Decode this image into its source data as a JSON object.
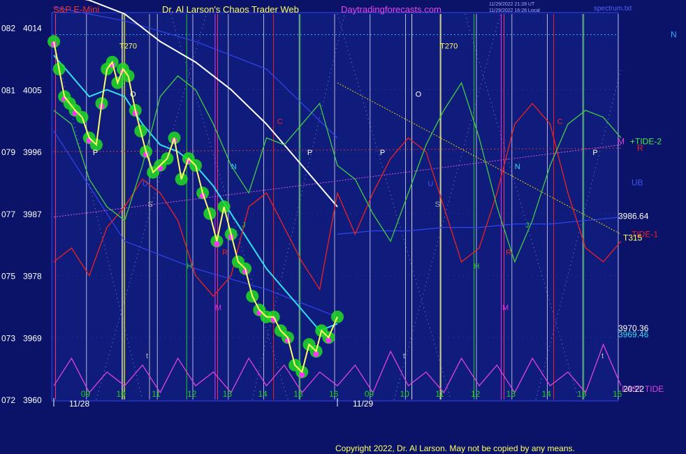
{
  "header": {
    "symbol": "S&P E-Mini",
    "site_title": "Dr. Al Larson's Chaos Trader Web",
    "site_url": "Daytradingforecasts.com",
    "timestamp_line1": "11/29/2022 21:28 UT",
    "timestamp_line2": "11/29/2022 16:28 Local",
    "spectrum_file": "spectrum.txt"
  },
  "footer": {
    "copyright": "Copyright 2022, Dr. Al Larson. May not be copied by any means."
  },
  "colors": {
    "background": "#0a1368",
    "plot_background": "#101c7c",
    "price": "#ffff66",
    "price_glow_bars": "#22dd22",
    "price_dots": "#ff33ff",
    "ema_fast": "#33ddee",
    "ema_slow": "#ffffff",
    "tide_1": "#ee2222",
    "tide_2": "#44cc44",
    "fast_tide": "#dd44dd",
    "channel": "#3344ee",
    "trendline": "#e8d000"
  },
  "chart_data": {
    "type": "line",
    "title": "S&P E-Mini",
    "y_ticks": [
      {
        "code": "082",
        "price": "4014"
      },
      {
        "code": "081",
        "price": "4005"
      },
      {
        "code": "079",
        "price": "3996"
      },
      {
        "code": "077",
        "price": "3987"
      },
      {
        "code": "075",
        "price": "3978"
      },
      {
        "code": "073",
        "price": "3969"
      },
      {
        "code": "072",
        "price": "3960"
      }
    ],
    "ylim": [
      3960,
      4016
    ],
    "x_hours": [
      "09",
      "10",
      "11",
      "12",
      "13",
      "14",
      "15",
      "16",
      "09",
      "10",
      "11",
      "12",
      "13",
      "14",
      "15",
      "16"
    ],
    "x_dates": [
      "11/28",
      "11/29"
    ],
    "grid": true,
    "series": [
      {
        "name": "price",
        "x": [
          0,
          0.15,
          0.3,
          0.45,
          0.6,
          0.8,
          1.0,
          1.2,
          1.35,
          1.5,
          1.65,
          1.8,
          1.95,
          2.1,
          2.3,
          2.45,
          2.6,
          2.8,
          3.0,
          3.2,
          3.4,
          3.6,
          3.8,
          4.0,
          4.2,
          4.4,
          4.6,
          4.8,
          5.0,
          5.2,
          5.4,
          5.6,
          5.8,
          6.0,
          6.2,
          6.4,
          6.6,
          6.8,
          7.0,
          7.2,
          7.4,
          7.55,
          7.75,
          8.0
        ],
        "values": [
          4012,
          4008,
          4004,
          4003,
          4002,
          4001,
          3998,
          3997,
          4003,
          4008,
          4009,
          4006,
          4008,
          4007,
          4002,
          3999,
          3996,
          3993,
          3994,
          3995,
          3998,
          3992,
          3995,
          3994,
          3990,
          3987,
          3983,
          3988,
          3984,
          3980,
          3979,
          3975,
          3973,
          3972,
          3972,
          3970,
          3969,
          3965,
          3964,
          3968,
          3967,
          3970,
          3969,
          3972
        ]
      },
      {
        "name": "ema_fast",
        "x": [
          0,
          0.5,
          1.0,
          1.5,
          2.0,
          2.5,
          3.0,
          3.5,
          4.0,
          4.5,
          5.0,
          5.5,
          6.0,
          6.5,
          7.0,
          7.5,
          8.0
        ],
        "values": [
          4010,
          4007,
          4004,
          4005,
          4004,
          4000,
          3997,
          3996,
          3994,
          3991,
          3987,
          3983,
          3979,
          3976,
          3973,
          3970,
          3971
        ]
      },
      {
        "name": "ema_slow",
        "x": [
          0,
          1.0,
          2.0,
          3.0,
          4.0,
          5.0,
          6.0,
          7.0,
          8.0
        ],
        "values": [
          4019,
          4018,
          4016,
          4012,
          4009,
          4005,
          4000,
          3994,
          3988
        ]
      },
      {
        "name": "TIDE-1",
        "x": [
          0,
          0.5,
          1.0,
          1.5,
          2.0,
          2.5,
          3.0,
          3.5,
          4.0,
          4.5,
          5.0,
          5.5,
          6.0,
          6.5,
          7.0,
          7.5,
          8.0,
          8.5,
          9.0,
          9.5,
          10.0,
          10.5,
          11.0,
          11.5,
          12.0,
          12.5,
          13.0,
          13.5,
          14.0,
          14.5,
          15.0,
          15.5,
          16.0
        ],
        "values": [
          3980,
          3982,
          3978,
          3985,
          3988,
          3992,
          3990,
          3986,
          3978,
          3975,
          3978,
          3988,
          3990,
          3985,
          3980,
          3976,
          3990,
          3984,
          3990,
          3995,
          3998,
          3996,
          3988,
          3980,
          3982,
          3990,
          4000,
          4003,
          4000,
          3990,
          3982,
          3980,
          3983
        ]
      },
      {
        "name": "+TIDE-2",
        "x": [
          0,
          0.5,
          1.0,
          1.5,
          2.0,
          2.5,
          3.0,
          3.5,
          4.0,
          4.5,
          5.0,
          5.5,
          6.0,
          6.5,
          7.0,
          7.5,
          8.0,
          8.5,
          9.0,
          9.5,
          10.0,
          10.5,
          11.0,
          11.5,
          12.0,
          12.5,
          13.0,
          13.5,
          14.0,
          14.5,
          15.0,
          15.5,
          16.0
        ],
        "values": [
          4002,
          4000,
          3992,
          3988,
          3986,
          3994,
          4004,
          4007,
          4005,
          4000,
          3994,
          3990,
          3998,
          3997,
          4000,
          4003,
          3994,
          3992,
          3987,
          3983,
          3990,
          3997,
          4002,
          4006,
          3998,
          3988,
          3980,
          3986,
          3994,
          4000,
          4002,
          4001,
          3998
        ]
      },
      {
        "name": "FAST TIDE",
        "x": [
          0,
          0.5,
          1.0,
          1.5,
          2.0,
          2.5,
          3.0,
          3.5,
          4.0,
          4.5,
          5.0,
          5.5,
          6.0,
          6.5,
          7.0,
          7.5,
          8.0,
          8.5,
          9.0,
          9.5,
          10.0,
          10.5,
          11.0,
          11.5,
          12.0,
          12.5,
          13.0,
          13.5,
          14.0,
          14.5,
          15.0,
          15.5,
          16.0
        ],
        "values": [
          3962,
          3966,
          3961,
          3964,
          3962,
          3965,
          3961,
          3966,
          3962,
          3964,
          3961,
          3966,
          3962,
          3965,
          3961,
          3964,
          3962,
          3965,
          3961,
          3967,
          3962,
          3964,
          3961,
          3966,
          3962,
          3965,
          3961,
          3966,
          3962,
          3964,
          3961,
          3968,
          3962
        ]
      }
    ],
    "right_labels": [
      {
        "text": "N",
        "value": 4013
      },
      {
        "text": "+TIDE-2",
        "value": 3997.5
      },
      {
        "text": "R",
        "value": 3996.5
      },
      {
        "text": "M",
        "value": 3997.5
      },
      {
        "text": "UB",
        "value": 3991.5
      },
      {
        "text": "3986.64",
        "value": 3986.64
      },
      {
        "text": "-TIDE-1",
        "value": 3984
      },
      {
        "text": "T315",
        "value": 3983.5
      },
      {
        "text": "3970.36",
        "value": 3970.36
      },
      {
        "text": "3969.46",
        "value": 3969.46
      },
      {
        "text": "FAST TIDE",
        "value": 3961.5
      },
      {
        "text": "20:22",
        "value": 3961.5
      }
    ],
    "annotations": [
      {
        "text": "T270",
        "x": 1.85,
        "value": 4011
      },
      {
        "text": "T270",
        "x": 10.9,
        "value": 4011
      },
      {
        "text": "P",
        "x": 1.1,
        "value": 3995.5
      },
      {
        "text": "P",
        "x": 7.15,
        "value": 3995.5
      },
      {
        "text": "P",
        "x": 9.2,
        "value": 3995.5
      },
      {
        "text": "P",
        "x": 15.2,
        "value": 3995.5
      },
      {
        "text": "O",
        "x": 2.15,
        "value": 4004
      },
      {
        "text": "O",
        "x": 10.2,
        "value": 4004
      },
      {
        "text": "S",
        "x": 2.65,
        "value": 3988
      },
      {
        "text": "S",
        "x": 10.75,
        "value": 3988
      },
      {
        "text": "N",
        "x": 5.0,
        "value": 3993.5
      },
      {
        "text": "N",
        "x": 13.0,
        "value": 3993.5
      },
      {
        "text": "C",
        "x": 6.3,
        "value": 4000
      },
      {
        "text": "C",
        "x": 14.2,
        "value": 4000
      },
      {
        "text": "H",
        "x": 3.75,
        "value": 3979
      },
      {
        "text": "H",
        "x": 11.85,
        "value": 3979
      },
      {
        "text": "M",
        "x": 4.55,
        "value": 3973
      },
      {
        "text": "M",
        "x": 12.65,
        "value": 3973
      },
      {
        "text": "R",
        "x": 4.75,
        "value": 3981
      },
      {
        "text": "R",
        "x": 12.75,
        "value": 3981
      },
      {
        "text": "J",
        "x": 5.3,
        "value": 3985
      },
      {
        "text": "J",
        "x": 13.3,
        "value": 3985
      },
      {
        "text": "U",
        "x": 2.5,
        "value": 3991
      },
      {
        "text": "U",
        "x": 10.55,
        "value": 3991
      },
      {
        "text": "t",
        "x": 2.6,
        "value": 3966
      },
      {
        "text": "t",
        "x": 9.85,
        "value": 3966
      },
      {
        "text": "t",
        "x": 15.45,
        "value": 3966
      }
    ]
  }
}
